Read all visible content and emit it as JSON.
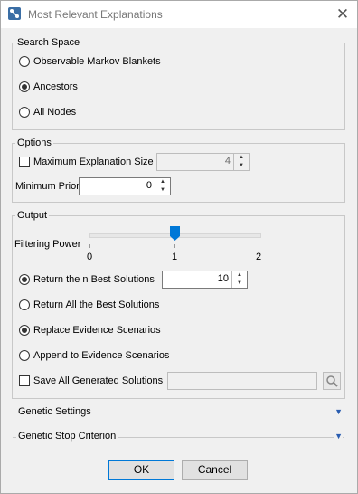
{
  "window": {
    "title": "Most Relevant Explanations"
  },
  "search_space": {
    "legend": "Search Space",
    "options": [
      {
        "label": "Observable Markov Blankets",
        "checked": false
      },
      {
        "label": "Ancestors",
        "checked": true
      },
      {
        "label": "All Nodes",
        "checked": false
      }
    ]
  },
  "options": {
    "legend": "Options",
    "max_explanation_size": {
      "label": "Maximum Explanation Size",
      "checked": false,
      "value": "4"
    },
    "min_prior": {
      "label": "Minimum Prior",
      "value": "0"
    }
  },
  "output": {
    "legend": "Output",
    "filtering_power": {
      "label": "Filtering Power",
      "ticks": [
        "0",
        "1",
        "2"
      ],
      "value": 1,
      "min": 0,
      "max": 2
    },
    "return_n_best": {
      "label": "Return the n Best Solutions",
      "checked": true,
      "value": "10"
    },
    "return_all_best": {
      "label": "Return All the Best Solutions",
      "checked": false
    },
    "replace_evidence": {
      "label": "Replace Evidence Scenarios",
      "checked": true
    },
    "append_evidence": {
      "label": "Append to Evidence Scenarios",
      "checked": false
    },
    "save_all": {
      "label": "Save All Generated Solutions",
      "checked": false,
      "path": ""
    }
  },
  "genetic_settings": {
    "label": "Genetic Settings"
  },
  "genetic_stop": {
    "label": "Genetic Stop Criterion"
  },
  "buttons": {
    "ok": "OK",
    "cancel": "Cancel"
  }
}
